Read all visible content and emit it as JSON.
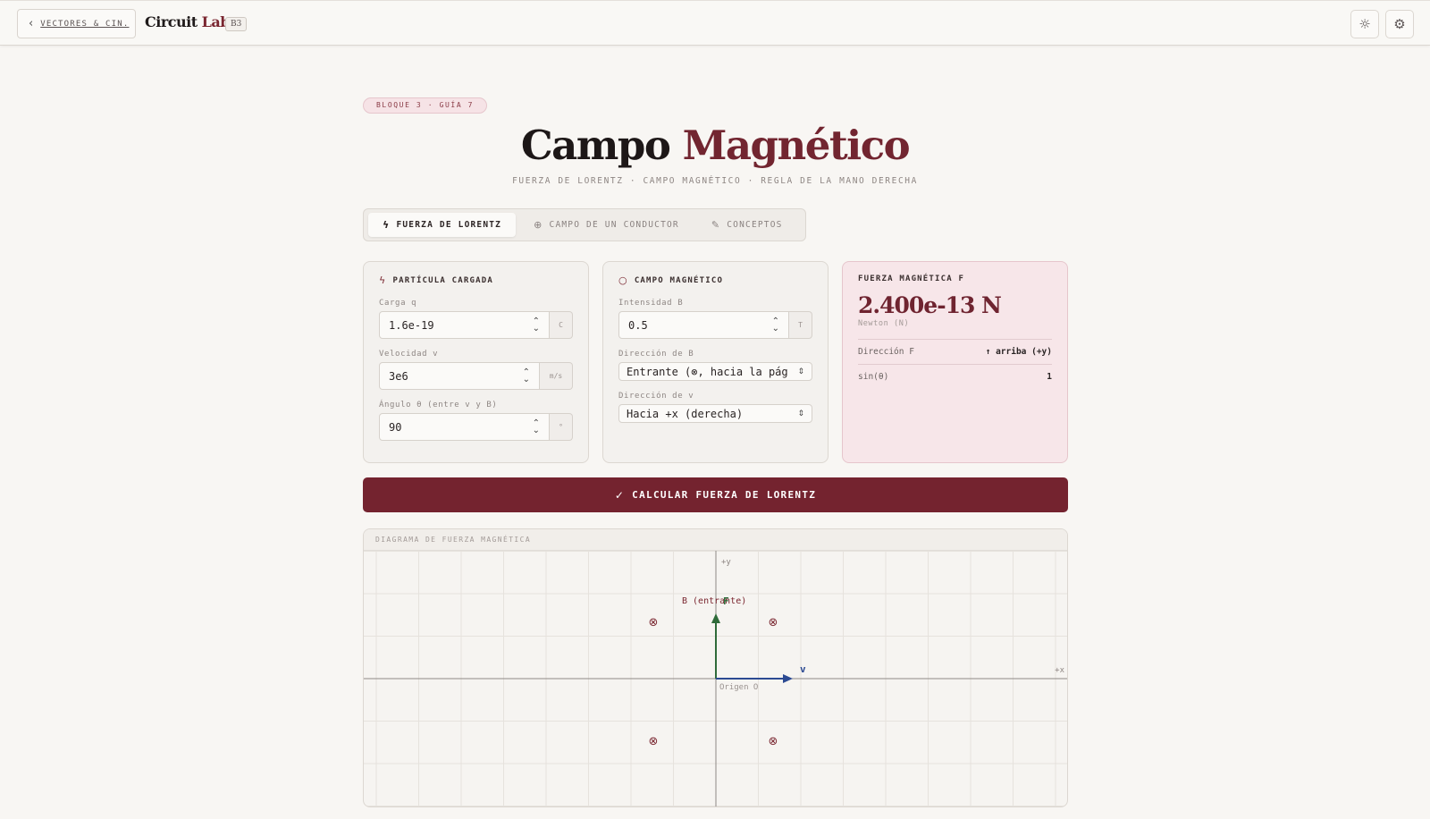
{
  "topbar": {
    "back_label": "VECTORES & CIN.",
    "brand_primary": "Circuit",
    "brand_accent": "Lab",
    "brand_badge": "B3",
    "theme_icon": "sun-icon",
    "settings_icon": "gear-icon"
  },
  "header": {
    "pill": "BLOQUE 3 · GUÍA 7",
    "title_primary": "Campo",
    "title_accent": "Magnético",
    "subtitle": "FUERZA DE LORENTZ · CAMPO MAGNÉTICO · REGLA DE LA MANO DERECHA"
  },
  "tabs": [
    {
      "label": "FUERZA DE LORENTZ",
      "icon": "bolt-icon",
      "active": true
    },
    {
      "label": "CAMPO DE UN CONDUCTOR",
      "icon": "circle-plus-icon",
      "active": false
    },
    {
      "label": "CONCEPTOS",
      "icon": "pencil-icon",
      "active": false
    }
  ],
  "particle": {
    "title": "PARTÍCULA CARGADA",
    "charge_label": "Carga q",
    "charge_value": "1.6e-19",
    "charge_unit": "C",
    "velocity_label": "Velocidad v",
    "velocity_value": "3e6",
    "velocity_unit": "m/s",
    "angle_label": "Ángulo θ (entre v y B)",
    "angle_value": "90",
    "angle_unit": "°"
  },
  "field": {
    "title": "CAMPO MAGNÉTICO",
    "intensity_label": "Intensidad B",
    "intensity_value": "0.5",
    "intensity_unit": "T",
    "b_dir_label": "Dirección de B",
    "b_dir_value": "Entrante (⊗, hacia la pág",
    "v_dir_label": "Dirección de v",
    "v_dir_value": "Hacia +x (derecha)"
  },
  "result": {
    "title": "FUERZA MAGNÉTICA F",
    "value": "2.400e-13 N",
    "unit": "Newton (N)",
    "dir_label": "Dirección F",
    "dir_value": "↑ arriba (+y)",
    "sin_label": "sin(θ)",
    "sin_value": "1"
  },
  "calc_button": "CALCULAR FUERZA DE LORENTZ",
  "diagram": {
    "title": "DIAGRAMA DE FUERZA MAGNÉTICA",
    "y_axis": "+y",
    "x_axis": "+x",
    "b_label": "B (entrante)",
    "f_label": "F",
    "v_label": "v",
    "origin_label": "Origen O",
    "field_symbol": "⊗",
    "colors": {
      "force": "#2f6b3a",
      "velocity": "#2c4a92",
      "field": "#7a2630"
    }
  }
}
